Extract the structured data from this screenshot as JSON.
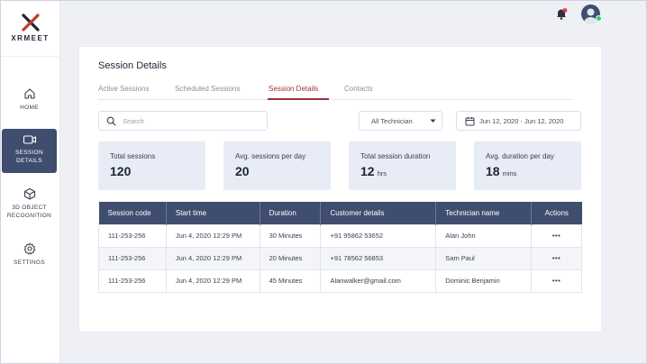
{
  "brand": {
    "logo_text": "XRMEET"
  },
  "sidebar": {
    "items": [
      {
        "label": "HOME",
        "icon": "home-icon"
      },
      {
        "label_line1": "SESSION",
        "label_line2": "DETAILS",
        "icon": "video-icon",
        "active": true
      },
      {
        "label_line1": "3D OBJECT",
        "label_line2": "RECOGNITION",
        "icon": "cube-icon"
      },
      {
        "label": "SETTINGS",
        "icon": "gear-icon"
      }
    ]
  },
  "header": {
    "notification_icon": "bell-icon",
    "avatar_icon": "user-avatar"
  },
  "page": {
    "title": "Session Details"
  },
  "tabs": [
    "Active Sessions",
    "Scheduled Sessions",
    "Session Details",
    "Contacts"
  ],
  "active_tab": "Session Details",
  "filters": {
    "search_placeholder": "Search",
    "technician_value": "All Technician",
    "date_range": "Jun 12, 2020 - Jun 12, 2020"
  },
  "stats": [
    {
      "label": "Total sessions",
      "value": "120",
      "unit": ""
    },
    {
      "label": "Avg. sessions per day",
      "value": "20",
      "unit": ""
    },
    {
      "label": "Total session duration",
      "value": "12",
      "unit": "hrs"
    },
    {
      "label": "Avg. duration per day",
      "value": "18",
      "unit": "mins"
    }
  ],
  "table": {
    "columns": [
      "Session code",
      "Start time",
      "Duration",
      "Customer details",
      "Technician name",
      "Actions"
    ],
    "rows": [
      [
        "111-253-256",
        "Jun 4, 2020 12:29 PM",
        "30 Minutes",
        "+91 95862 53652",
        "Alan John",
        "•••"
      ],
      [
        "111-253-256",
        "Jun 4, 2020 12:29 PM",
        "20 Minutes",
        "+91 78562 56853",
        "Sam Paul",
        "•••"
      ],
      [
        "111-253-256",
        "Jun 4, 2020 12:29 PM",
        "45 Minutes",
        "Alanwalker@gmail.com",
        "Dominic Benjamin",
        "•••"
      ]
    ]
  },
  "colors": {
    "accent": "#a0303a",
    "nav_active": "#3f4d6e",
    "stat_bg": "#e7ecf6",
    "online": "#2ecc71"
  }
}
